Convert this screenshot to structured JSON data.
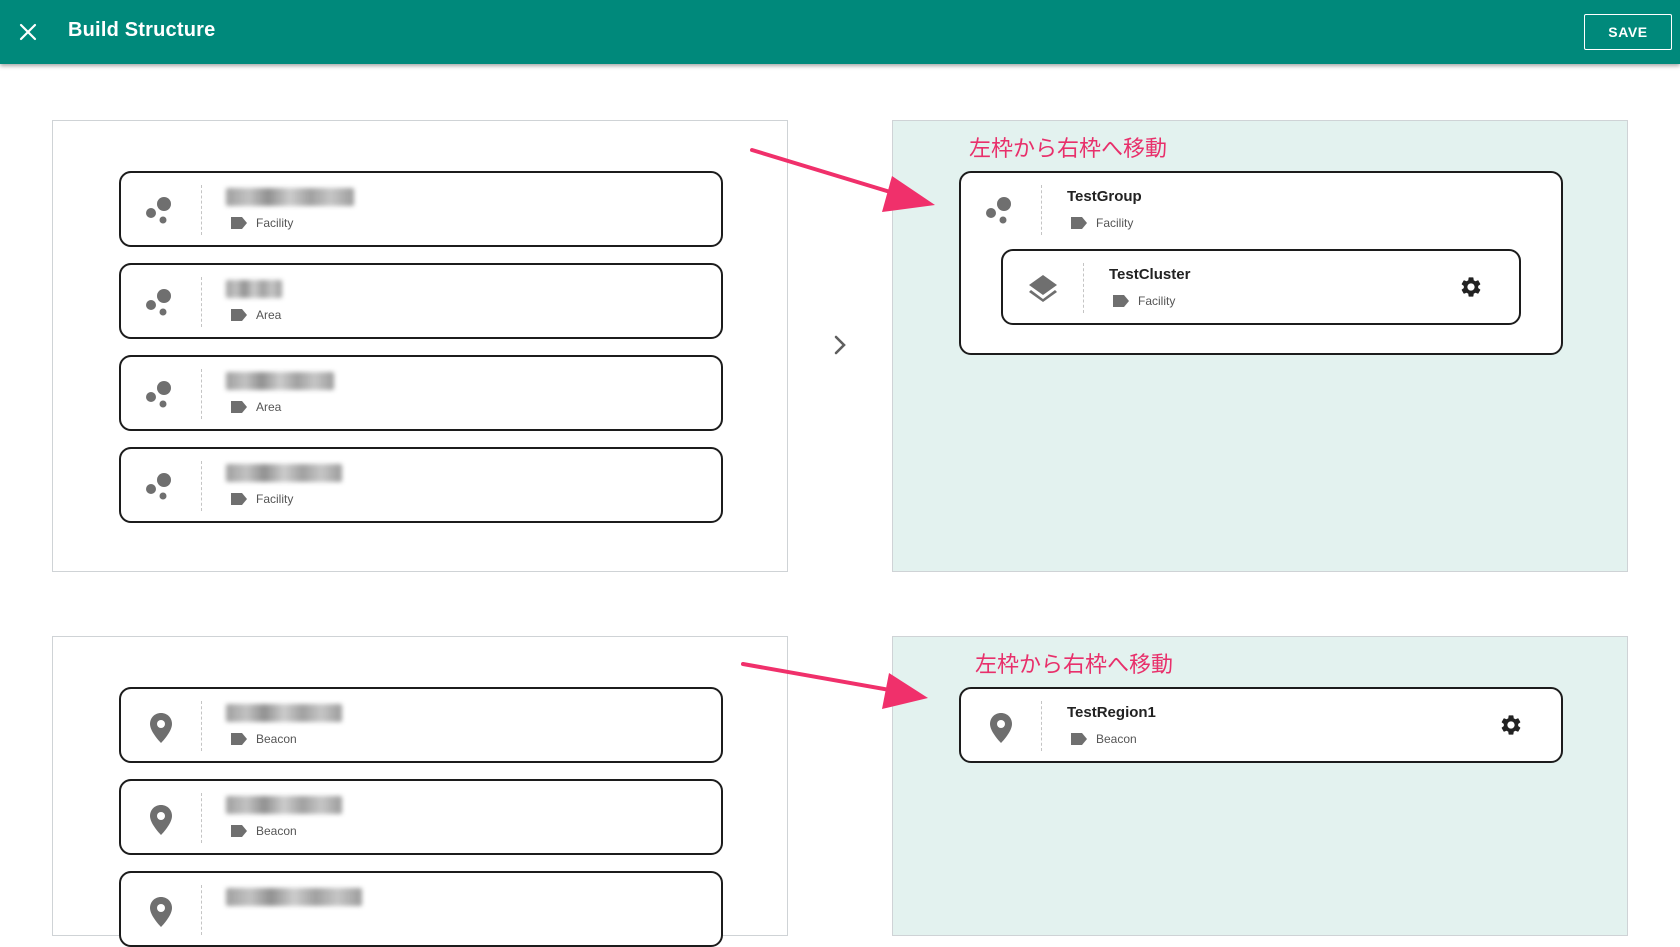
{
  "app": {
    "title": "Build Structure",
    "save_label": "SAVE"
  },
  "annotation_text": "左枠から右枠へ移動",
  "source_top": [
    {
      "type": "Facility"
    },
    {
      "type": "Area"
    },
    {
      "type": "Area"
    },
    {
      "type": "Facility"
    }
  ],
  "target_top": {
    "group": {
      "name": "TestGroup",
      "type": "Facility"
    },
    "child": {
      "name": "TestCluster",
      "type": "Facility"
    }
  },
  "source_bottom": [
    {
      "type": "Beacon"
    },
    {
      "type": "Beacon"
    }
  ],
  "target_bottom": {
    "name": "TestRegion1",
    "type": "Beacon"
  },
  "colors": {
    "appbar": "#00897b",
    "target_panel": "#e3f2ef",
    "annotation": "#e8306b"
  }
}
